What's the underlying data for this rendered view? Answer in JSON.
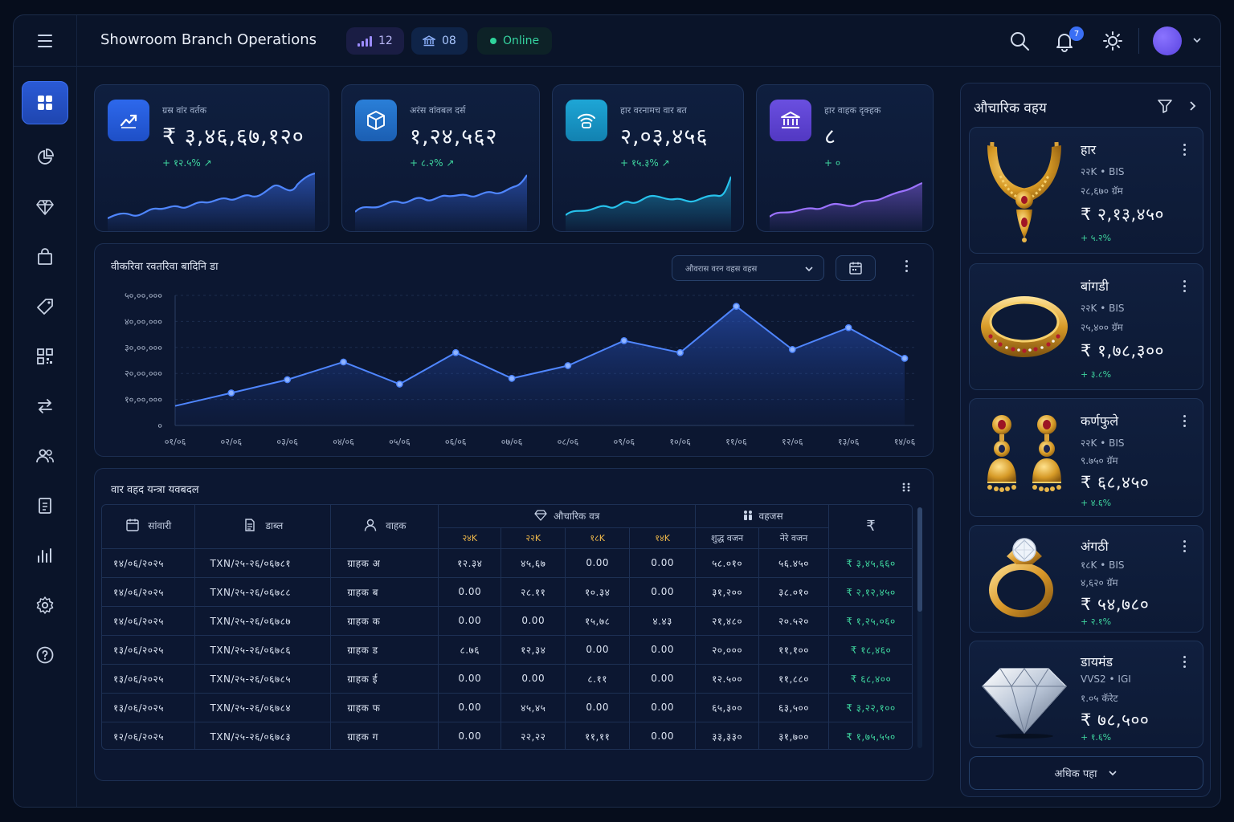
{
  "header": {
    "title": "Showroom Branch Operations",
    "signal_count": "12",
    "branch_count": "08",
    "status": "Online",
    "notification_count": "7"
  },
  "colors": {
    "accent": "#3a6ff5",
    "positive": "#3fd69f",
    "gold": "#f0b94a",
    "background": "#0a1429"
  },
  "sidebar": {
    "items": [
      {
        "icon": "dashboard-icon",
        "active": true
      },
      {
        "icon": "pie-chart-icon"
      },
      {
        "icon": "diamond-icon"
      },
      {
        "icon": "shopping-bag-icon"
      },
      {
        "icon": "tag-icon"
      },
      {
        "icon": "qr-code-icon"
      },
      {
        "icon": "transfer-icon"
      },
      {
        "icon": "users-icon"
      },
      {
        "icon": "clipboard-icon"
      },
      {
        "icon": "bar-chart-icon"
      },
      {
        "icon": "settings-icon"
      },
      {
        "icon": "help-icon"
      }
    ]
  },
  "kpis": [
    {
      "label": "ग्रस्र वांर वर्तक",
      "value": "₹ ३,४६,६७,१२०",
      "delta": "+ १२.५% ↗"
    },
    {
      "label": "अरंस वांवबल दर्स",
      "value": "१,२४,५६२",
      "delta": "+ ८.२% ↗"
    },
    {
      "label": "हार वरनामच वार बत",
      "value": "२,०३,४५६",
      "delta": "+ १५.३% ↗"
    },
    {
      "label": "हार वाहक दृक्हक",
      "value": "८",
      "delta": "+ ०"
    }
  ],
  "trend": {
    "title": "वीकरिवा रवतरिवा बादिनि डा",
    "select_value": "औवरास वरन वहस वहस"
  },
  "chart_data": {
    "type": "area",
    "title": "वीकरिवा रवतरिवा बादिनि डा",
    "xlabel": "",
    "ylabel": "",
    "categories": [
      "०१/०६",
      "०२/०६",
      "०३/०६",
      "०४/०६",
      "०५/०६",
      "०६/०६",
      "०७/०६",
      "०८/०६",
      "०९/०६",
      "१०/०६",
      "११/०६",
      "१२/०६",
      "१३/०६",
      "१४/०६"
    ],
    "y_tick_labels": [
      "५०,००,०००",
      "४०,००,०००",
      "३०,००,०००",
      "२०,००,०००",
      "१०,००,०००",
      "०"
    ],
    "y_ticks": [
      5000000,
      4000000,
      3000000,
      2000000,
      1000000,
      0
    ],
    "ylim": [
      0,
      5000000
    ],
    "values": [
      750000,
      1250000,
      1760000,
      2440000,
      1590000,
      2800000,
      1810000,
      2300000,
      3260000,
      2800000,
      4580000,
      2920000,
      3760000,
      2580000
    ],
    "grid": true
  },
  "table": {
    "title": "वार वहद यन्त्रा यवबदल",
    "headers": {
      "date": "सांवारी",
      "txn": "डाब्ल",
      "customer": "वाहक",
      "jewellery_group": "औचारिक वत्र",
      "weight_group": "वहजस",
      "amount": "₹",
      "karats": [
        "२४K",
        "२२K",
        "१८K",
        "१४K"
      ],
      "weights": [
        "शुद्ध वजन",
        "नेरे वजन"
      ]
    },
    "rows": [
      [
        "१४/०६/२०२५",
        "TXN/२५-२६/०६७८१",
        "ग्राहक अ",
        "१२.३४",
        "४५,६७",
        "0.00",
        "0.00",
        "५८.०१०",
        "५६.४५०",
        "₹ ३,४५,६६०"
      ],
      [
        "१४/०६/२०२५",
        "TXN/२५-२६/०६७८८",
        "ग्राहक ब",
        "0.00",
        "२८.११",
        "१०.३४",
        "0.00",
        "३१,२००",
        "३८.०१०",
        "₹ २,१२,४५०"
      ],
      [
        "१४/०६/२०२५",
        "TXN/२५-२६/०६७८७",
        "ग्राहक क",
        "0.00",
        "0.00",
        "१५,७८",
        "४.४३",
        "२१,४८०",
        "२०.५२०",
        "₹ १,२५,०६०"
      ],
      [
        "१३/०६/२०२५",
        "TXN/२५-२६/०६७८६",
        "ग्राहक ड",
        "८.७६",
        "१२,३४",
        "0.00",
        "0.00",
        "२०,०००",
        "११,१००",
        "₹ १८,४६०"
      ],
      [
        "१३/०६/२०२५",
        "TXN/२५-२६/०६७८५",
        "ग्राहक ई",
        "0.00",
        "0.00",
        "८.११",
        "0.00",
        "१२.५००",
        "११,८८०",
        "₹ ६८,४००"
      ],
      [
        "१३/०६/२०२५",
        "TXN/२५-२६/०६७८४",
        "ग्राहक फ",
        "0.00",
        "४५,४५",
        "0.00",
        "0.00",
        "६५,३००",
        "६३,५००",
        "₹ ३,२२,१००"
      ],
      [
        "१२/०६/२०२५",
        "TXN/२५-२६/०६७८३",
        "ग्राहक ग",
        "0.00",
        "२२,२२",
        "११,११",
        "0.00",
        "३३,३३०",
        "३१,७००",
        "₹ १,७५,५५०"
      ]
    ]
  },
  "panel": {
    "title": "औचारिक वहय",
    "items": [
      {
        "name": "हार",
        "karat": "२२K",
        "cert": "BIS",
        "weight": "२८,६७० ग्रॅम",
        "price": "₹ २,१३,४५०",
        "change": "+ ५.२%",
        "icon": "necklace-icon"
      },
      {
        "name": "बांगडी",
        "karat": "२२K",
        "cert": "BIS",
        "weight": "२५,४०० ग्रॅम",
        "price": "₹ १,७८,३००",
        "change": "+ ३.८%",
        "icon": "bangle-icon"
      },
      {
        "name": "कर्णफुले",
        "karat": "२२K",
        "cert": "BIS",
        "weight": "९.७५० ग्रॅम",
        "price": "₹ ६८,४५०",
        "change": "+ ४.६%",
        "icon": "earrings-icon"
      },
      {
        "name": "अंगठी",
        "karat": "१८K",
        "cert": "BIS",
        "weight": "४,६२० ग्रॅम",
        "price": "₹ ५४,७८०",
        "change": "+ २.१%",
        "icon": "ring-icon"
      },
      {
        "name": "डायमंड",
        "karat": "VVS2",
        "cert": "IGI",
        "weight": "१.०५ कॅरेट",
        "price": "₹ ७८,५००",
        "change": "+ १.६%",
        "icon": "diamond-icon"
      }
    ],
    "more_label": "अधिक पहा"
  }
}
